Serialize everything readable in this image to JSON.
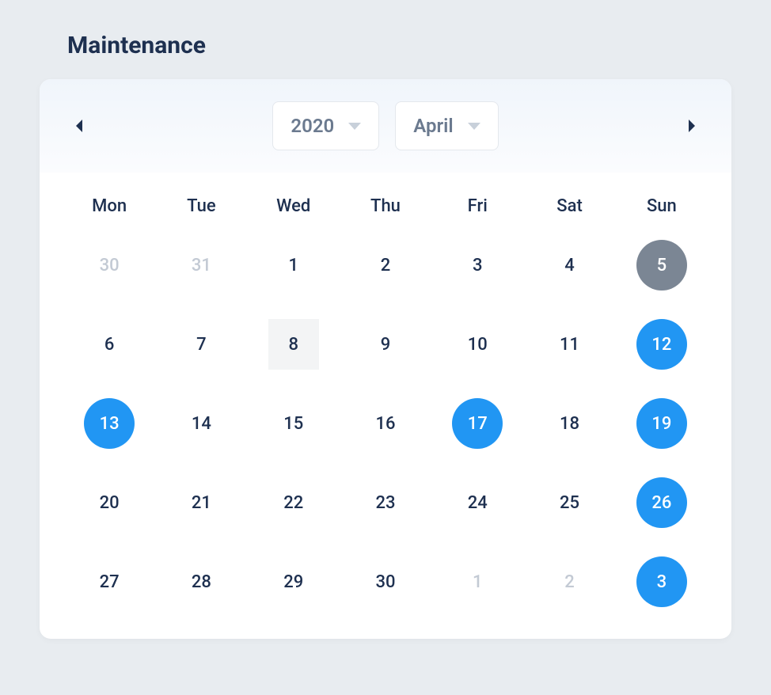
{
  "title": "Maintenance",
  "header": {
    "year": "2020",
    "month": "April"
  },
  "weekdays": [
    "Mon",
    "Tue",
    "Wed",
    "Thu",
    "Fri",
    "Sat",
    "Sun"
  ],
  "days": [
    {
      "label": "30",
      "state": "other-month"
    },
    {
      "label": "31",
      "state": "other-month"
    },
    {
      "label": "1",
      "state": "normal"
    },
    {
      "label": "2",
      "state": "normal"
    },
    {
      "label": "3",
      "state": "normal"
    },
    {
      "label": "4",
      "state": "normal"
    },
    {
      "label": "5",
      "state": "today"
    },
    {
      "label": "6",
      "state": "normal"
    },
    {
      "label": "7",
      "state": "normal"
    },
    {
      "label": "8",
      "state": "hovered"
    },
    {
      "label": "9",
      "state": "normal"
    },
    {
      "label": "10",
      "state": "normal"
    },
    {
      "label": "11",
      "state": "normal"
    },
    {
      "label": "12",
      "state": "selected"
    },
    {
      "label": "13",
      "state": "selected"
    },
    {
      "label": "14",
      "state": "normal"
    },
    {
      "label": "15",
      "state": "normal"
    },
    {
      "label": "16",
      "state": "normal"
    },
    {
      "label": "17",
      "state": "selected"
    },
    {
      "label": "18",
      "state": "normal"
    },
    {
      "label": "19",
      "state": "selected"
    },
    {
      "label": "20",
      "state": "normal"
    },
    {
      "label": "21",
      "state": "normal"
    },
    {
      "label": "22",
      "state": "normal"
    },
    {
      "label": "23",
      "state": "normal"
    },
    {
      "label": "24",
      "state": "normal"
    },
    {
      "label": "25",
      "state": "normal"
    },
    {
      "label": "26",
      "state": "selected"
    },
    {
      "label": "27",
      "state": "normal"
    },
    {
      "label": "28",
      "state": "normal"
    },
    {
      "label": "29",
      "state": "normal"
    },
    {
      "label": "30",
      "state": "normal"
    },
    {
      "label": "1",
      "state": "other-month"
    },
    {
      "label": "2",
      "state": "other-month"
    },
    {
      "label": "3",
      "state": "selected"
    }
  ]
}
